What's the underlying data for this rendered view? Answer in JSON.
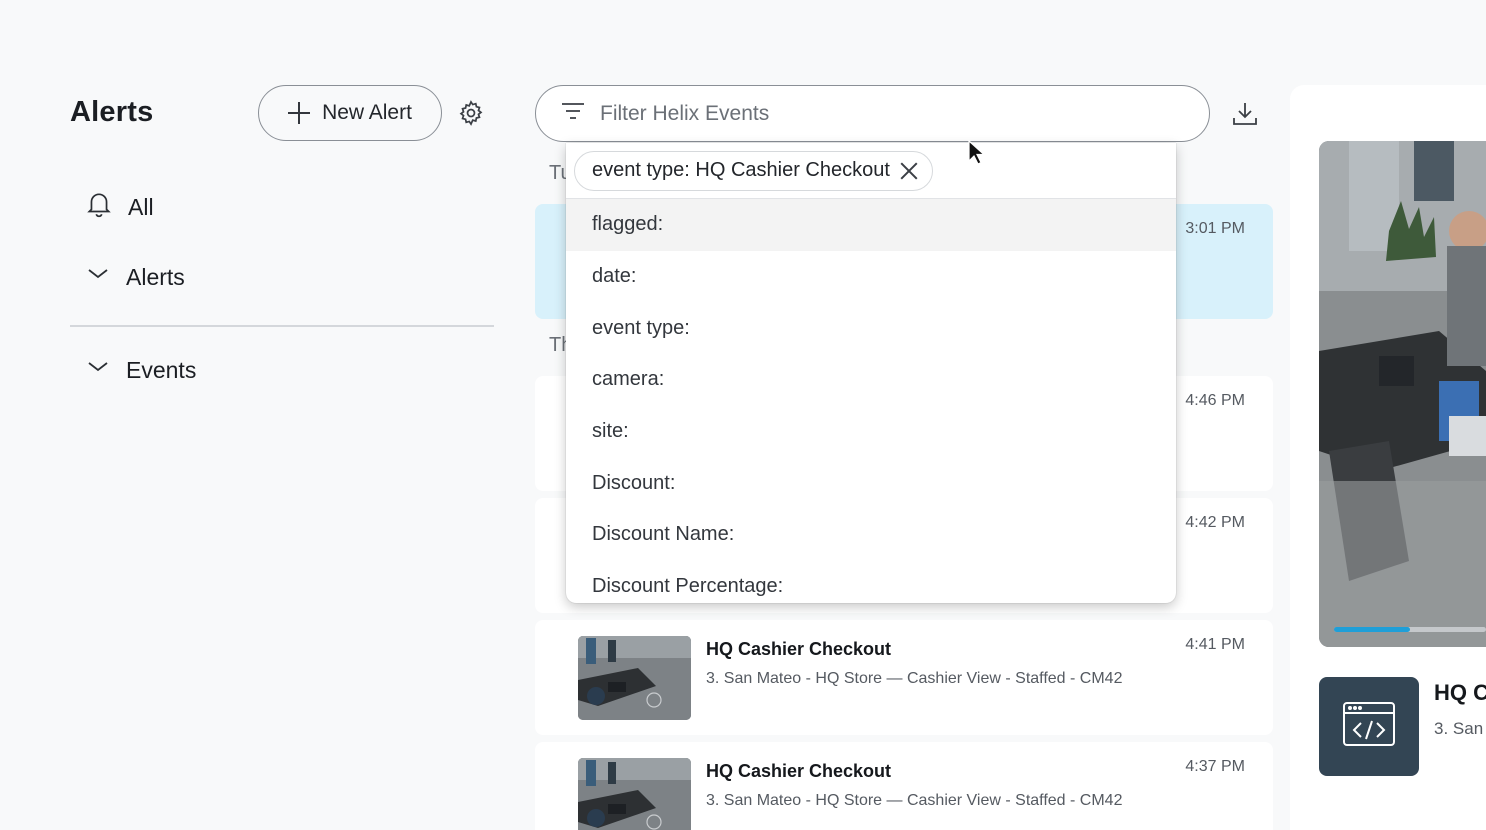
{
  "sidebar": {
    "title": "Alerts",
    "new_alert_label": "New Alert",
    "nav": {
      "all": "All",
      "alerts": "Alerts",
      "events": "Events"
    }
  },
  "filter": {
    "placeholder": "Filter Helix Events",
    "active_chip": "event type: HQ Cashier Checkout",
    "options": [
      "flagged:",
      "date:",
      "event type:",
      "camera:",
      "site:",
      "Discount:",
      "Discount Name:",
      "Discount Percentage:"
    ]
  },
  "events": {
    "day_headers": [
      "Tu",
      "Th"
    ],
    "items": [
      {
        "time": "3:01 PM",
        "title": "",
        "subtitle": ""
      },
      {
        "time": "4:46 PM",
        "title": "",
        "subtitle": ""
      },
      {
        "time": "4:42 PM",
        "title": "",
        "subtitle": ""
      },
      {
        "time": "4:41 PM",
        "title": "HQ Cashier Checkout",
        "subtitle": "3. San Mateo - HQ Store — Cashier View - Staffed - CM42"
      },
      {
        "time": "4:37 PM",
        "title": "HQ Cashier Checkout",
        "subtitle": "3. San Mateo - HQ Store — Cashier View - Staffed - CM42"
      }
    ]
  },
  "preview": {
    "title": "HQ C",
    "subtitle": "3. San",
    "progress": 0.5
  },
  "colors": {
    "accent": "#1f9fd8",
    "selected_row": "#d8f1fb",
    "code_tile": "#334554"
  }
}
